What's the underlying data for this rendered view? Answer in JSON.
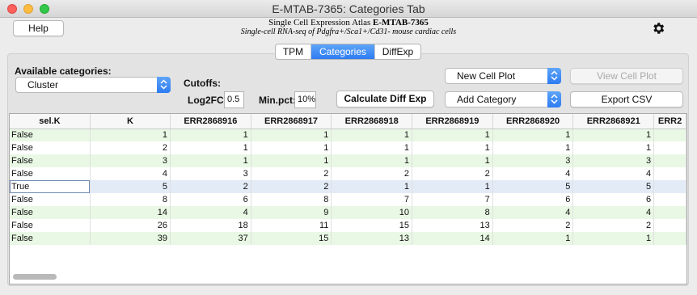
{
  "window": {
    "title": "E-MTAB-7365: Categories Tab"
  },
  "header": {
    "help_label": "Help",
    "line1_prefix": "Single Cell Expression Atlas",
    "line1_id": "E-MTAB-7365",
    "line2": "Single-cell RNA-seq of Pdgfra+/Sca1+/Cd31- mouse cardiac cells"
  },
  "tabs": [
    {
      "label": "TPM",
      "active": false
    },
    {
      "label": "Categories",
      "active": true
    },
    {
      "label": "DiffExp",
      "active": false
    }
  ],
  "controls": {
    "available_label": "Available categories:",
    "category_selected": "Cluster",
    "cutoffs_label": "Cutoffs:",
    "log2fc_label": "Log2FC:",
    "log2fc_value": "0.5",
    "minpct_label": "Min.pct:",
    "minpct_value": "10%",
    "calc_diff_label": "Calculate Diff Exp",
    "new_cell_plot": "New Cell Plot",
    "view_cell_plot": "View Cell Plot",
    "add_category": "Add Category",
    "export_csv": "Export CSV"
  },
  "table": {
    "columns": [
      "sel.K",
      "K",
      "ERR2868916",
      "ERR2868917",
      "ERR2868918",
      "ERR2868919",
      "ERR2868920",
      "ERR2868921",
      "ERR2"
    ],
    "rows": [
      [
        "False",
        "1",
        "1",
        "1",
        "1",
        "1",
        "1",
        "1",
        ""
      ],
      [
        "False",
        "2",
        "1",
        "1",
        "1",
        "1",
        "1",
        "1",
        ""
      ],
      [
        "False",
        "3",
        "1",
        "1",
        "1",
        "1",
        "3",
        "3",
        ""
      ],
      [
        "False",
        "4",
        "3",
        "2",
        "2",
        "2",
        "4",
        "4",
        ""
      ],
      [
        "True",
        "5",
        "2",
        "2",
        "1",
        "1",
        "5",
        "5",
        ""
      ],
      [
        "False",
        "8",
        "6",
        "8",
        "7",
        "7",
        "6",
        "6",
        ""
      ],
      [
        "False",
        "14",
        "4",
        "9",
        "10",
        "8",
        "4",
        "4",
        ""
      ],
      [
        "False",
        "26",
        "18",
        "11",
        "15",
        "13",
        "2",
        "2",
        ""
      ],
      [
        "False",
        "39",
        "37",
        "15",
        "13",
        "14",
        "1",
        "1",
        ""
      ]
    ],
    "selected_row": 4
  },
  "colors": {
    "accent": "#2d7cf2",
    "row_alt": "#e9f8e4",
    "row_selected": "#e3ebf7"
  },
  "icons": [
    "gear-icon",
    "chevron-updown-icon"
  ]
}
